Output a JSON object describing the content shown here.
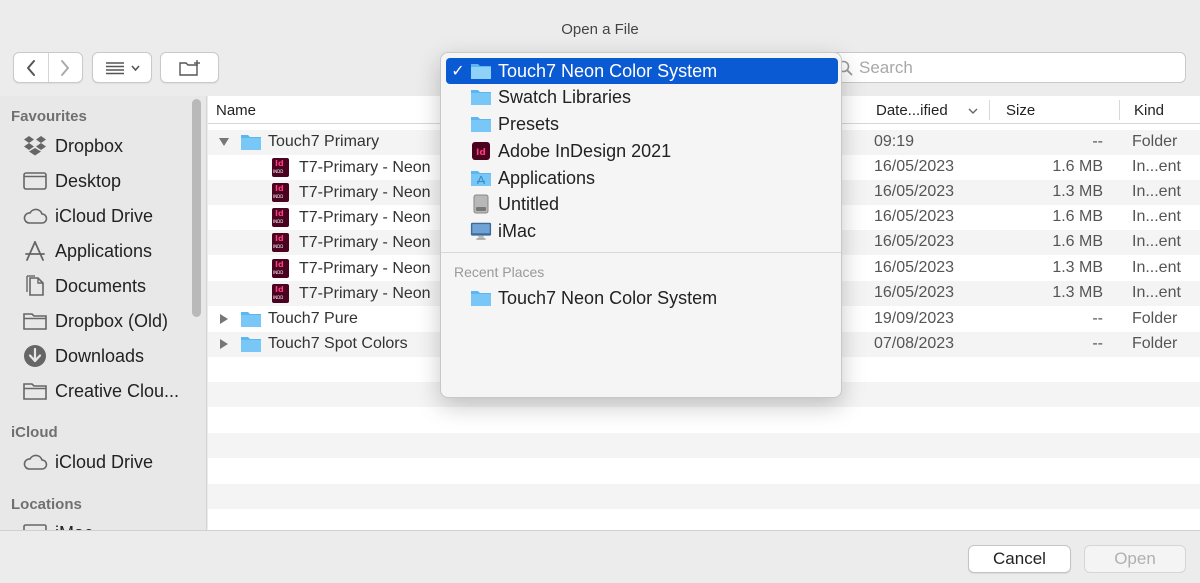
{
  "window": {
    "title": "Open a File"
  },
  "toolbar": {
    "back_icon": "chevron-left-icon",
    "forward_icon": "chevron-right-icon",
    "view_icon": "list-view-icon",
    "new_folder_icon": "new-folder-icon",
    "search_placeholder": "Search"
  },
  "sidebar": {
    "favourites_heading": "Favourites",
    "favourites": [
      {
        "label": "Dropbox",
        "icon": "dropbox-icon"
      },
      {
        "label": "Desktop",
        "icon": "desktop-icon"
      },
      {
        "label": "iCloud Drive",
        "icon": "cloud-icon"
      },
      {
        "label": "Applications",
        "icon": "applications-icon"
      },
      {
        "label": "Documents",
        "icon": "document-icon"
      },
      {
        "label": "Dropbox (Old)",
        "icon": "folder-icon"
      },
      {
        "label": "Downloads",
        "icon": "download-icon"
      },
      {
        "label": "Creative Clou...",
        "icon": "folder-icon"
      }
    ],
    "icloud_heading": "iCloud",
    "icloud": [
      {
        "label": "iCloud Drive",
        "icon": "cloud-icon"
      }
    ],
    "locations_heading": "Locations",
    "locations": [
      {
        "label": "iMac",
        "icon": "imac-icon"
      }
    ]
  },
  "columns": {
    "name": "Name",
    "date": "Date...ified",
    "size": "Size",
    "kind": "Kind"
  },
  "files": [
    {
      "name": "Touch7 Primary",
      "type": "folder",
      "expanded": true,
      "indent": 0,
      "date": "09:19",
      "size": "--",
      "kind": "Folder"
    },
    {
      "name": "T7-Primary - Neon",
      "type": "indd",
      "indent": 1,
      "date": "16/05/2023",
      "size": "1.6 MB",
      "kind": "In...ent"
    },
    {
      "name": "T7-Primary - Neon",
      "type": "indd",
      "indent": 1,
      "date": "16/05/2023",
      "size": "1.3 MB",
      "kind": "In...ent"
    },
    {
      "name": "T7-Primary - Neon",
      "type": "indd",
      "indent": 1,
      "date": "16/05/2023",
      "size": "1.6 MB",
      "kind": "In...ent"
    },
    {
      "name": "T7-Primary - Neon",
      "type": "indd",
      "indent": 1,
      "date": "16/05/2023",
      "size": "1.6 MB",
      "kind": "In...ent"
    },
    {
      "name": "T7-Primary - Neon",
      "type": "indd",
      "indent": 1,
      "date": "16/05/2023",
      "size": "1.3 MB",
      "kind": "In...ent"
    },
    {
      "name": "T7-Primary - Neon",
      "type": "indd",
      "indent": 1,
      "date": "16/05/2023",
      "size": "1.3 MB",
      "kind": "In...ent"
    },
    {
      "name": "Touch7 Pure",
      "type": "folder",
      "expanded": false,
      "indent": 0,
      "date": "19/09/2023",
      "size": "--",
      "kind": "Folder"
    },
    {
      "name": "Touch7 Spot Colors",
      "type": "folder",
      "expanded": false,
      "indent": 0,
      "date": "07/08/2023",
      "size": "--",
      "kind": "Folder"
    }
  ],
  "path_popup": {
    "items": [
      {
        "label": "Touch7 Neon Color System",
        "icon": "folder-icon",
        "selected": true
      },
      {
        "label": "Swatch Libraries",
        "icon": "folder-icon"
      },
      {
        "label": "Presets",
        "icon": "folder-icon"
      },
      {
        "label": "Adobe InDesign 2021",
        "icon": "indesign-app-icon"
      },
      {
        "label": "Applications",
        "icon": "applications-folder-icon"
      },
      {
        "label": "Untitled",
        "icon": "disk-icon"
      },
      {
        "label": "iMac",
        "icon": "imac-icon"
      }
    ],
    "recent_heading": "Recent Places",
    "recent": [
      {
        "label": "Touch7 Neon Color System",
        "icon": "folder-icon"
      }
    ]
  },
  "buttons": {
    "cancel": "Cancel",
    "open": "Open"
  },
  "colors": {
    "accent": "#0a5ad4",
    "folder": "#5ab7f2",
    "indesign": "#49021f"
  }
}
